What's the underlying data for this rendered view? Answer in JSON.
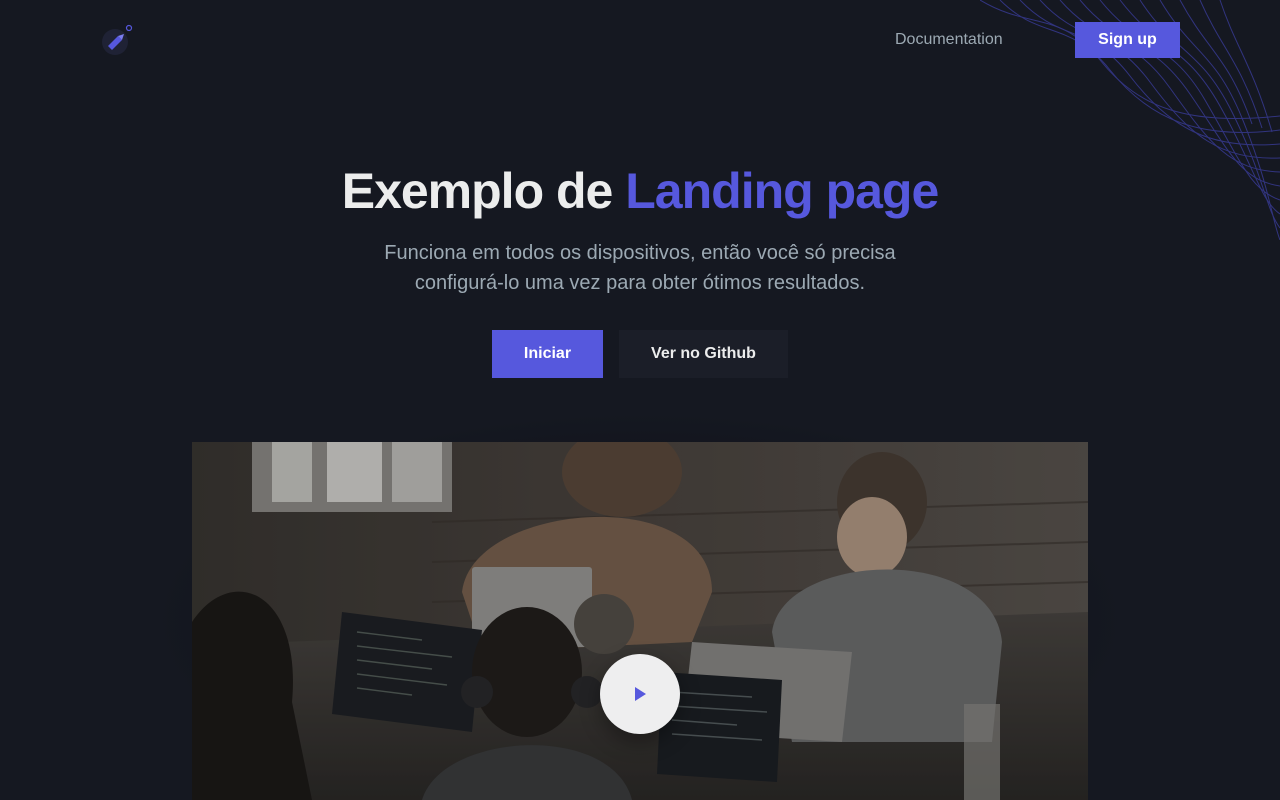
{
  "header": {
    "logo_icon": "rocket-logo-icon",
    "nav_documentation": "Documentation",
    "signup_label": "Sign up"
  },
  "hero": {
    "title_main": "Exemplo de",
    "title_accent": "Landing page",
    "subtitle": "Funciona em todos os dispositivos, então você só precisa configurá-lo uma vez para obter ótimos resultados.",
    "primary_button": "Iniciar",
    "secondary_button": "Ver no Github"
  },
  "video": {
    "play_icon": "play-icon"
  },
  "colors": {
    "background": "#151821",
    "accent": "#5658dd",
    "text": "#eceded",
    "muted": "#9ca9b3"
  }
}
